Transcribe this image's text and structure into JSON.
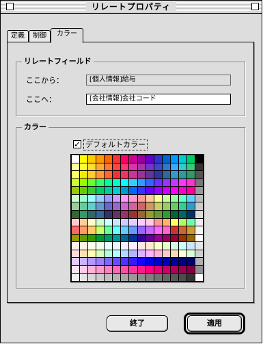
{
  "window": {
    "title": "リレートプロパティ"
  },
  "tabs": [
    {
      "label": "定義"
    },
    {
      "label": "制御"
    },
    {
      "label": "カラー"
    }
  ],
  "relate_field": {
    "group_title": "リレートフィールド",
    "from_label": "ここから：",
    "from_value": "[個人情報]給与",
    "to_label": "ここへ：",
    "to_value": "[会社情報]会社コード"
  },
  "color": {
    "group_title": "カラー",
    "default_checkbox_checked": true,
    "default_checkbox_mark": "✓",
    "default_color_label": "デフォルトカラー"
  },
  "palette_colors": [
    "#ffffff",
    "#ffff00",
    "#ffcc00",
    "#ff9900",
    "#ff6600",
    "#ff3333",
    "#ff0066",
    "#cc0099",
    "#990099",
    "#6600cc",
    "#3333cc",
    "#0066cc",
    "#0099ff",
    "#00cccc",
    "#00cc66",
    "#000000",
    "#ffff99",
    "#ffff33",
    "#ffdd33",
    "#ffaa33",
    "#ff7733",
    "#ff4444",
    "#ff3377",
    "#dd33aa",
    "#aa33aa",
    "#7733cc",
    "#4444cc",
    "#3377cc",
    "#33aaff",
    "#33cccc",
    "#33cc77",
    "#333333",
    "#ffff66",
    "#eeee00",
    "#ffcc33",
    "#ff9933",
    "#ff6633",
    "#ee3333",
    "#ee3366",
    "#cc3399",
    "#993399",
    "#663399",
    "#333399",
    "#336699",
    "#3399cc",
    "#339999",
    "#339966",
    "#555555",
    "#ccff33",
    "#99ff00",
    "#66ff33",
    "#33ff66",
    "#00ff99",
    "#00ffcc",
    "#00ffff",
    "#33ccff",
    "#3399ff",
    "#3366ff",
    "#6633ff",
    "#9933ff",
    "#cc33ff",
    "#ff33ff",
    "#ff33cc",
    "#777777",
    "#99cc00",
    "#66cc00",
    "#33cc33",
    "#00cc66",
    "#00cc99",
    "#00cccc",
    "#0099cc",
    "#0066ff",
    "#3333ff",
    "#6600ff",
    "#9900ff",
    "#cc00ff",
    "#ff00ff",
    "#ff00cc",
    "#ff0099",
    "#999999",
    "#ccffcc",
    "#99ffcc",
    "#99ffff",
    "#99ccff",
    "#9999ff",
    "#cc99ff",
    "#ff99ff",
    "#ff99cc",
    "#ff9999",
    "#ffcc99",
    "#ffff99",
    "#ccff99",
    "#99ff99",
    "#66ffcc",
    "#66ccff",
    "#bbbbbb",
    "#99cc99",
    "#66cc99",
    "#66cccc",
    "#6699cc",
    "#6666cc",
    "#9966cc",
    "#cc66cc",
    "#cc6699",
    "#cc6666",
    "#cc9966",
    "#cccc66",
    "#99cc66",
    "#66cc66",
    "#33cc99",
    "#3399cc",
    "#cccccc",
    "#336633",
    "#339966",
    "#336666",
    "#336699",
    "#333366",
    "#663366",
    "#993366",
    "#993333",
    "#996633",
    "#999933",
    "#669933",
    "#339933",
    "#006633",
    "#006666",
    "#003366",
    "#dddddd",
    "#ffcccc",
    "#ffcc99",
    "#ffffcc",
    "#ccffcc",
    "#ccffff",
    "#cce5ff",
    "#ccccff",
    "#e5ccff",
    "#ffccff",
    "#ffcce5",
    "#ff9999",
    "#ffb366",
    "#ffff66",
    "#b3ff66",
    "#66ffb3",
    "#eeeeee",
    "#ff6666",
    "#ff9966",
    "#ffcc66",
    "#ccff66",
    "#66ff99",
    "#66ffff",
    "#66ccff",
    "#6699ff",
    "#9966ff",
    "#cc66ff",
    "#ff66ff",
    "#ff66cc",
    "#cc3333",
    "#cc6633",
    "#cc9933",
    "#f5f5f5",
    "#999900",
    "#669900",
    "#339900",
    "#009933",
    "#009966",
    "#009999",
    "#006699",
    "#003399",
    "#330099",
    "#660099",
    "#990099",
    "#990066",
    "#990033",
    "#993300",
    "#996600",
    "#ffffff",
    "#fff0f0",
    "#fff5e6",
    "#fffff0",
    "#f0fff0",
    "#f0ffff",
    "#f0f5ff",
    "#f5f0ff",
    "#fff0ff",
    "#ffe6e6",
    "#ffedcc",
    "#ffffcc",
    "#e6ffcc",
    "#ccffe6",
    "#ccffff",
    "#cce6ff",
    "#e6e6e6",
    "#ffd9d9",
    "#ffe0b3",
    "#ffffb3",
    "#d9ffb3",
    "#b3ffd9",
    "#b3ffff",
    "#b3d9ff",
    "#b3b3ff",
    "#d9b3ff",
    "#ffb3ff",
    "#ffb3d9",
    "#ffcccc",
    "#ffd9b3",
    "#ffffd9",
    "#d9ffd9",
    "#d0d0d0",
    "#e6ccff",
    "#ccb3ff",
    "#b399ff",
    "#9980ff",
    "#8066ff",
    "#664dff",
    "#4d33ff",
    "#331aff",
    "#1a00ff",
    "#0000e6",
    "#0000cc",
    "#0000b3",
    "#000099",
    "#000080",
    "#000066",
    "#b0b0b0",
    "#ffe6f2",
    "#ffcce6",
    "#ffb3d9",
    "#ff99cc",
    "#ff80bf",
    "#ff66b3",
    "#ff4da6",
    "#ff3399",
    "#ff1a8c",
    "#ff0080",
    "#e60073",
    "#cc0066",
    "#b30059",
    "#99004d",
    "#800040",
    "#909090",
    "#f2f2f2",
    "#e6e6e6",
    "#d9d9d9",
    "#cccccc",
    "#bfbfbf",
    "#b3b3b3",
    "#a6a6a6",
    "#999999",
    "#8c8c8c",
    "#808080",
    "#737373",
    "#666666",
    "#595959",
    "#4d4d4d",
    "#333333",
    "#ffffff"
  ],
  "buttons": {
    "quit_label": "終了",
    "apply_label": "適用"
  }
}
